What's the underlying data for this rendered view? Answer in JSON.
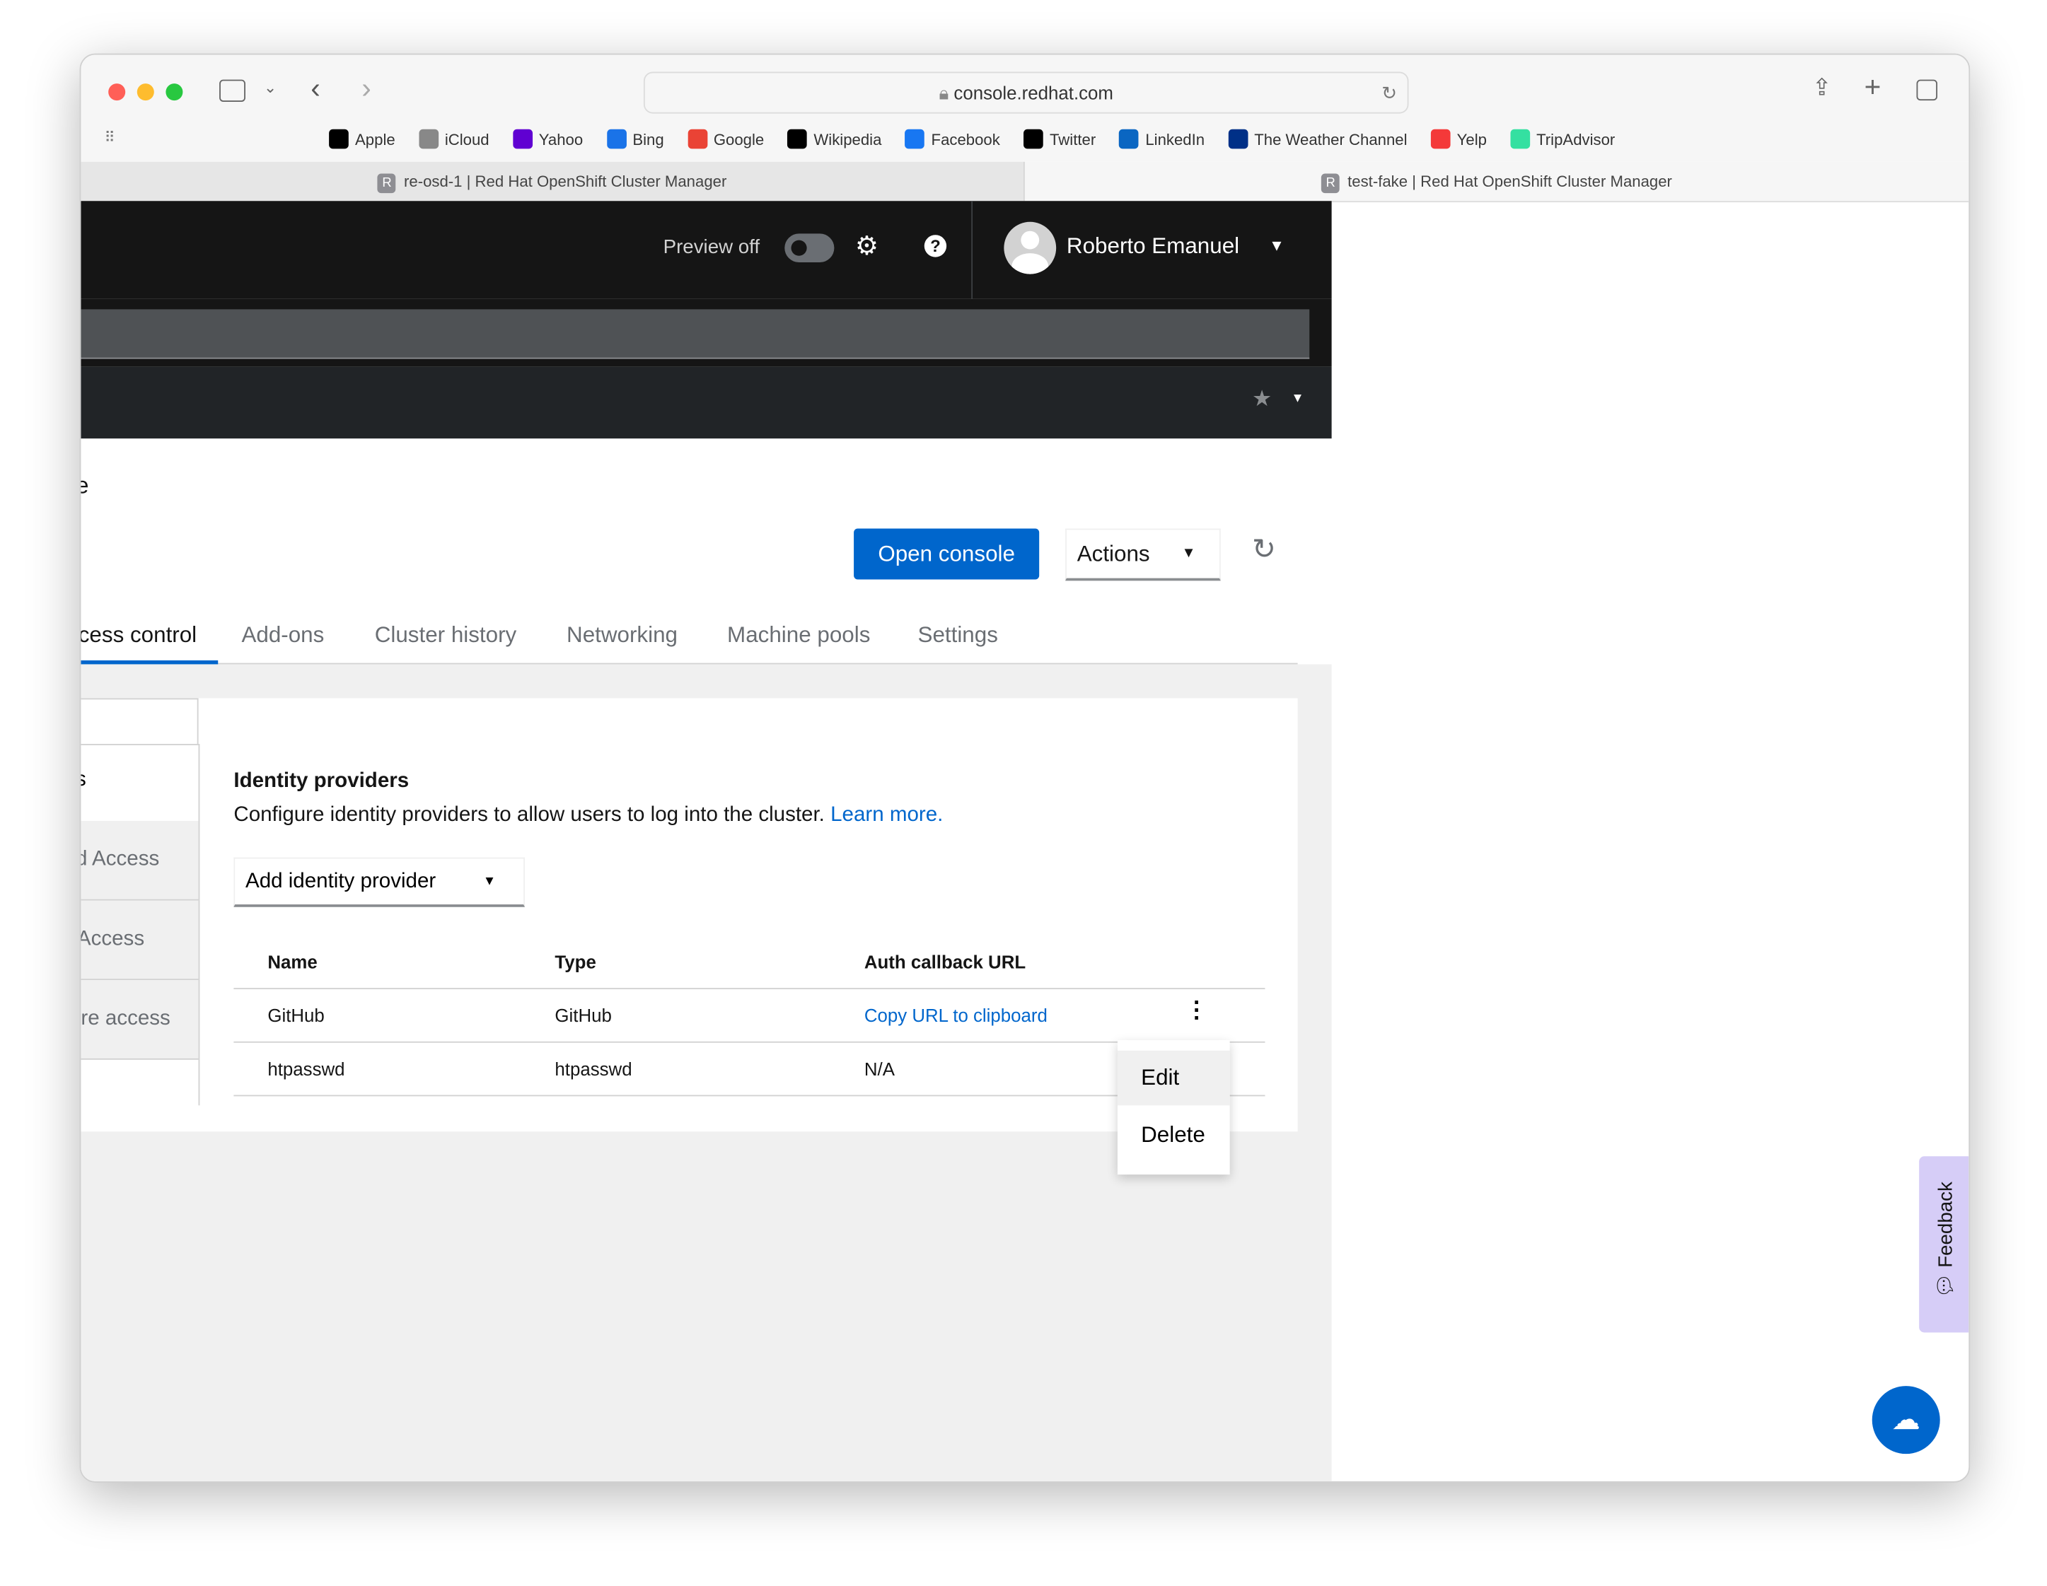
{
  "browser": {
    "url": "console.redhat.com",
    "bookmarks": [
      {
        "label": "Apple",
        "color": "#000"
      },
      {
        "label": "iCloud",
        "color": "#888"
      },
      {
        "label": "Yahoo",
        "color": "#6001d2"
      },
      {
        "label": "Bing",
        "color": "#1a73e8"
      },
      {
        "label": "Google",
        "color": "#ea4335"
      },
      {
        "label": "Wikipedia",
        "color": "#000"
      },
      {
        "label": "Facebook",
        "color": "#1877f2"
      },
      {
        "label": "Twitter",
        "color": "#000"
      },
      {
        "label": "LinkedIn",
        "color": "#0a66c2"
      },
      {
        "label": "The Weather Channel",
        "color": "#003087"
      },
      {
        "label": "Yelp",
        "color": "#f43939"
      },
      {
        "label": "TripAdvisor",
        "color": "#34e0a1"
      }
    ],
    "tabs": [
      {
        "label": "re-osd-1 | Red Hat OpenShift Cluster Manager",
        "active": true
      },
      {
        "label": "test-fake | Red Hat OpenShift Cluster Manager",
        "active": false
      }
    ]
  },
  "header": {
    "preview_label": "Preview off",
    "user_name": "Roberto Emanuel"
  },
  "title_fragment": "e",
  "toolbar": {
    "open_console": "Open console",
    "actions": "Actions"
  },
  "tabs": [
    "cess control",
    "Add-ons",
    "Cluster history",
    "Networking",
    "Machine pools",
    "Settings"
  ],
  "side_nav": {
    "heading_fragment": "s",
    "items": [
      "d Access",
      "Access",
      "re access"
    ]
  },
  "idp": {
    "title": "Identity providers",
    "description": "Configure identity providers to allow users to log into the cluster.",
    "learn_more": "Learn more.",
    "add_button": "Add identity provider",
    "columns": [
      "Name",
      "Type",
      "Auth callback URL"
    ],
    "rows": [
      {
        "name": "GitHub",
        "type": "GitHub",
        "url": "Copy URL to clipboard"
      },
      {
        "name": "htpasswd",
        "type": "htpasswd",
        "url": "N/A"
      }
    ]
  },
  "kebab_menu": [
    "Edit",
    "Delete"
  ],
  "feedback": "Feedback",
  "colors": {
    "accent": "#0066cc",
    "header": "#151515",
    "feedback": "#d6cdf7"
  }
}
